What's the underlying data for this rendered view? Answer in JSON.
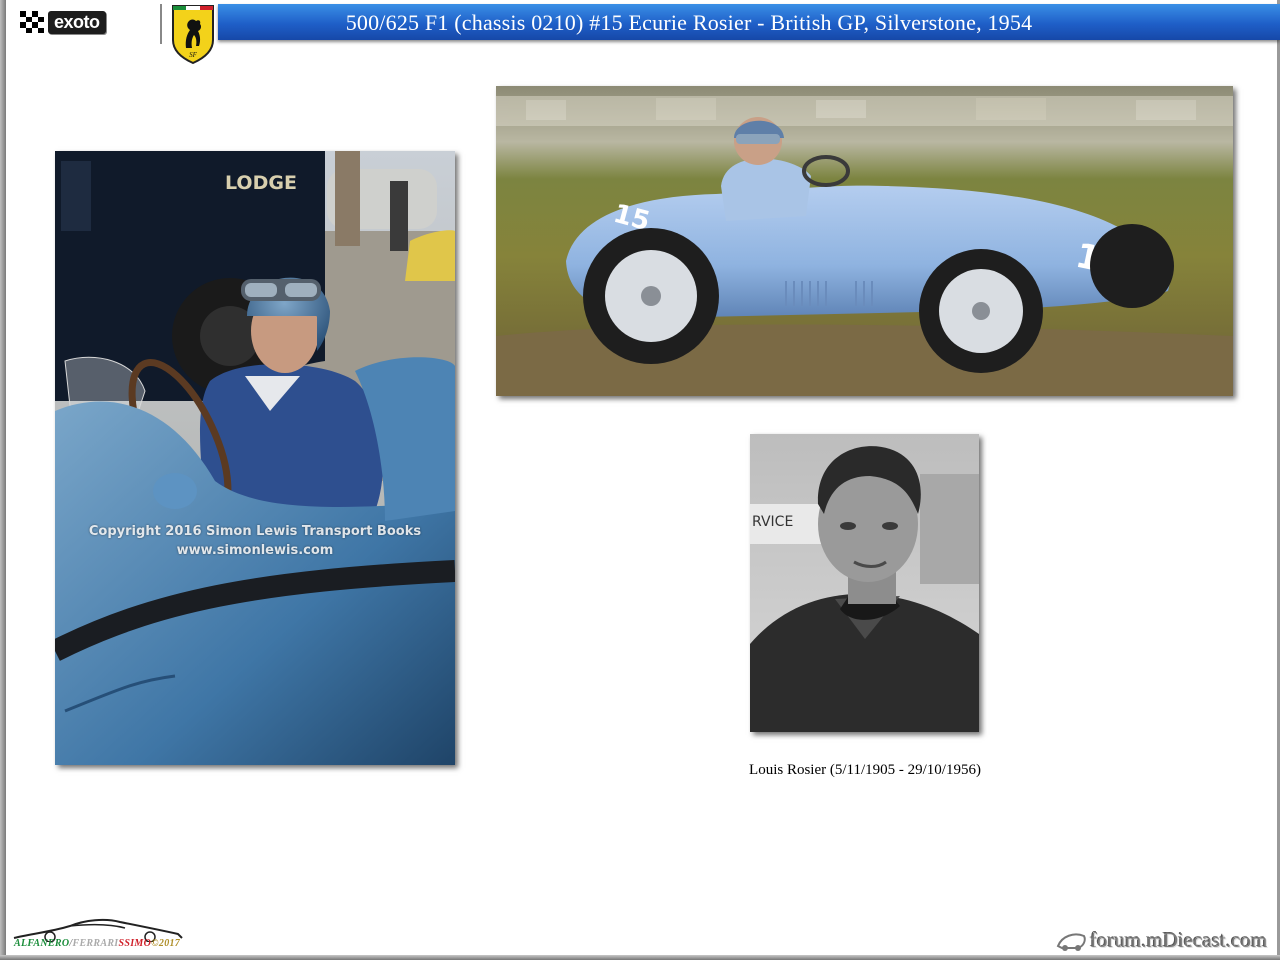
{
  "header": {
    "brand_logo": "exoto",
    "emblem_icon": "ferrari-prancing-horse-shield-icon",
    "title": "500/625 F1 (chassis 0210) #15 Ecurie Rosier - British GP, Silverstone, 1954"
  },
  "photos": {
    "left": {
      "van_lettering": "LODGE",
      "watermark_line1": "Copyright 2016 Simon Lewis Transport Books",
      "watermark_line2": "www.simonlewis.com"
    },
    "top_right": {
      "car_number": "15"
    },
    "portrait": {
      "caption": "Louis Rosier  (5/11/1905 - 29/10/1956)",
      "background_sign": "RVICE"
    }
  },
  "footer": {
    "left_logo": {
      "part1": "ALFANERO",
      "part2": "/",
      "part3": "FERRARI",
      "part4": "SSIMO",
      "part5": "©2017"
    },
    "right_logo": "forum.mDiecast.com"
  },
  "colors": {
    "title_bar": "#1f5fc8",
    "title_text": "#ffffff",
    "car_blue": "#8fb3e0"
  }
}
